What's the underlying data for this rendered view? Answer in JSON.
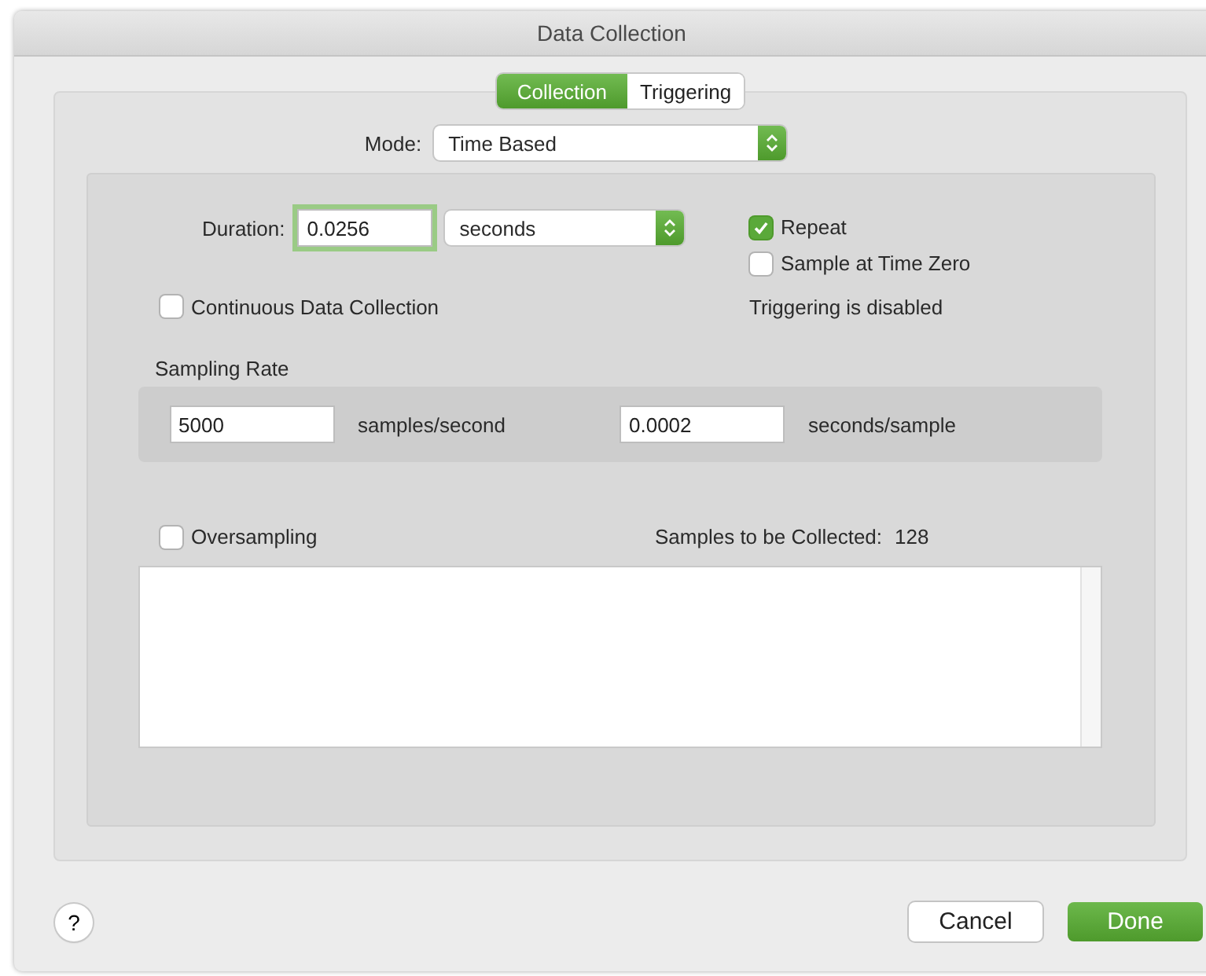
{
  "window": {
    "title": "Data Collection"
  },
  "tabs": [
    {
      "label": "Collection",
      "selected": true
    },
    {
      "label": "Triggering",
      "selected": false
    }
  ],
  "mode": {
    "label": "Mode:",
    "value": "Time Based"
  },
  "duration": {
    "label": "Duration:",
    "value": "0.0256",
    "focused": true,
    "unit": "seconds"
  },
  "options": [
    {
      "label": "Repeat",
      "checked": true
    },
    {
      "label": "Sample at Time Zero",
      "checked": false
    }
  ],
  "continuous": {
    "label": "Continuous Data Collection",
    "checked": false
  },
  "triggering_status": "Triggering is disabled",
  "sampling_rate": {
    "title": "Sampling Rate",
    "fields": [
      {
        "value": "5000",
        "unit": "samples/second"
      },
      {
        "value": "0.0002",
        "unit": "seconds/sample"
      }
    ]
  },
  "oversampling": {
    "label": "Oversampling",
    "checked": false
  },
  "samples_to_collect": {
    "label": "Samples to be Collected:",
    "value": "128"
  },
  "help_button": "?",
  "buttons": [
    {
      "label": "Cancel",
      "kind": "secondary"
    },
    {
      "label": "Done",
      "kind": "primary"
    }
  ]
}
